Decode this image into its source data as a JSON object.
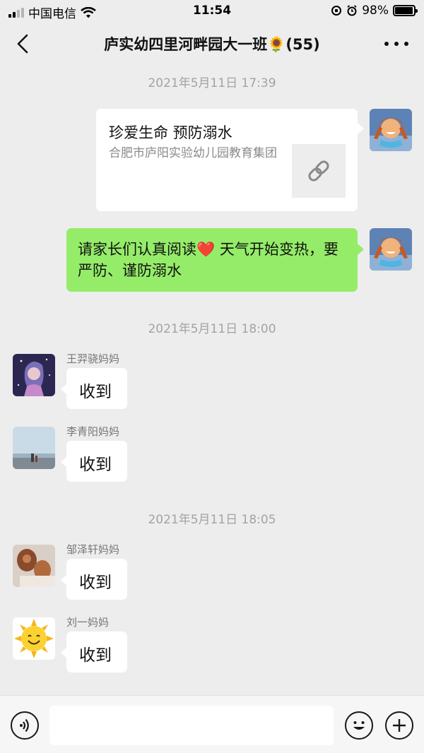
{
  "status_bar": {
    "carrier": "中国电信",
    "time": "11:54",
    "battery_percent": "98%",
    "battery_level": 0.98
  },
  "nav": {
    "title": "庐实幼四里河畔园大一班🌻(55)"
  },
  "messages": {
    "ts1": "2021年5月11日 17:39",
    "link_card": {
      "title": "珍爱生命  预防溺水",
      "source": "合肥市庐阳实验幼儿园教育集团",
      "icon": "link-icon"
    },
    "green_text": "请家长们认真阅读❤️  天气开始变热，要严防、谨防溺水",
    "ts2": "2021年5月11日 18:00",
    "reply1": {
      "name": "王羿骁妈妈",
      "text": "收到"
    },
    "reply2": {
      "name": "李青阳妈妈",
      "text": "收到"
    },
    "ts3": "2021年5月11日 18:05",
    "reply3": {
      "name": "邹泽轩妈妈",
      "text": "收到"
    },
    "reply4": {
      "name": "刘一妈妈",
      "text": "收到"
    }
  },
  "input_bar": {
    "voice_icon": "voice-icon",
    "emoji_icon": "emoji-icon",
    "plus_icon": "plus-icon",
    "input_value": ""
  },
  "colors": {
    "background": "#ededed",
    "green_bubble": "#95ec69",
    "timestamp": "#a3a3a3"
  }
}
